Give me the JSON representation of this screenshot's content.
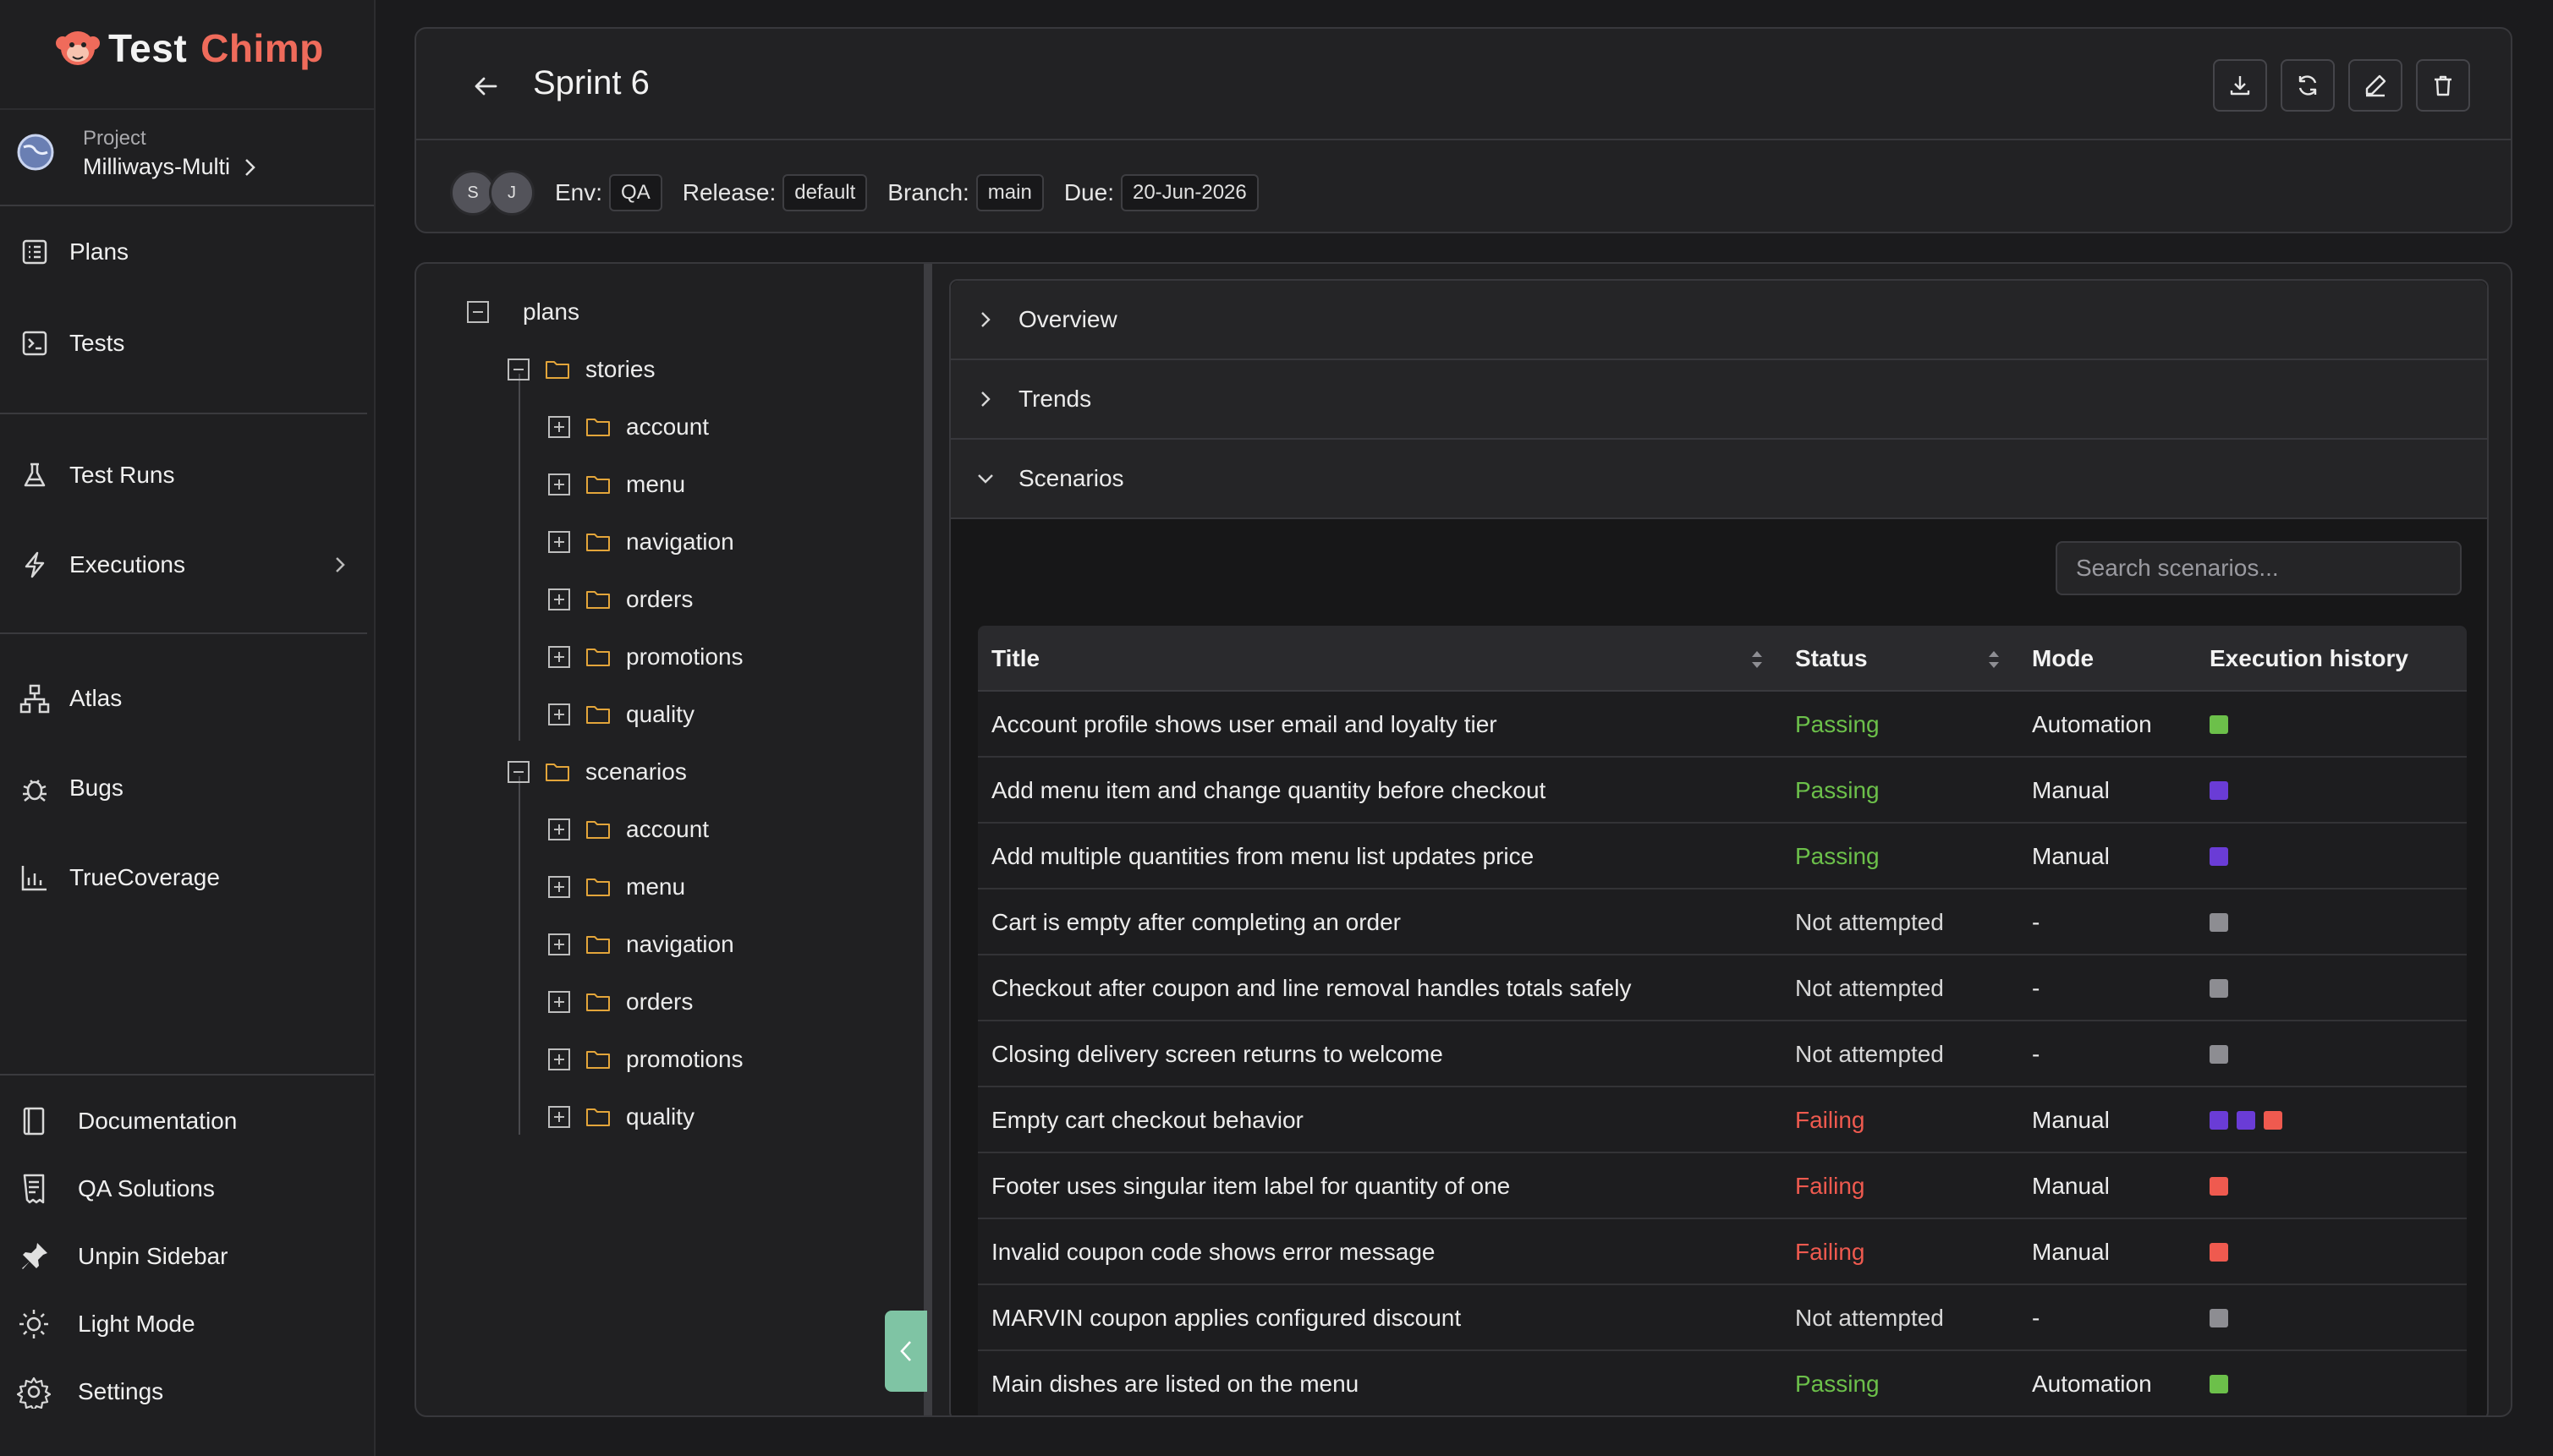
{
  "brand": {
    "word1": "Test",
    "word2": "Chimp"
  },
  "project": {
    "label": "Project",
    "name": "Milliways-Multi"
  },
  "nav": {
    "plans": "Plans",
    "tests": "Tests",
    "test_runs": "Test Runs",
    "executions": "Executions",
    "atlas": "Atlas",
    "bugs": "Bugs",
    "truecoverage": "TrueCoverage"
  },
  "bottom_nav": {
    "documentation": "Documentation",
    "qa_solutions": "QA Solutions",
    "unpin_sidebar": "Unpin Sidebar",
    "light_mode": "Light Mode",
    "settings": "Settings"
  },
  "header": {
    "title": "Sprint 6",
    "avatars": [
      "S",
      "J"
    ],
    "env_label": "Env:",
    "env_value": "QA",
    "release_label": "Release:",
    "release_value": "default",
    "branch_label": "Branch:",
    "branch_value": "main",
    "due_label": "Due:",
    "due_value": "20-Jun-2026"
  },
  "tree": {
    "root": "plans",
    "stories": {
      "label": "stories",
      "children": [
        "account",
        "menu",
        "navigation",
        "orders",
        "promotions",
        "quality"
      ]
    },
    "scenarios": {
      "label": "scenarios",
      "children": [
        "account",
        "menu",
        "navigation",
        "orders",
        "promotions",
        "quality"
      ]
    }
  },
  "accordion": {
    "overview": "Overview",
    "trends": "Trends",
    "scenarios": "Scenarios"
  },
  "search": {
    "placeholder": "Search scenarios..."
  },
  "table": {
    "headers": {
      "title": "Title",
      "status": "Status",
      "mode": "Mode",
      "history": "Execution history"
    },
    "rows": [
      {
        "title": "Account profile shows user email and loyalty tier",
        "status": "Passing",
        "mode": "Automation",
        "history": [
          "green"
        ]
      },
      {
        "title": "Add menu item and change quantity before checkout",
        "status": "Passing",
        "mode": "Manual",
        "history": [
          "purple"
        ]
      },
      {
        "title": "Add multiple quantities from menu list updates price",
        "status": "Passing",
        "mode": "Manual",
        "history": [
          "purple"
        ]
      },
      {
        "title": "Cart is empty after completing an order",
        "status": "Not attempted",
        "mode": "-",
        "history": [
          "gray"
        ]
      },
      {
        "title": "Checkout after coupon and line removal handles totals safely",
        "status": "Not attempted",
        "mode": "-",
        "history": [
          "gray"
        ]
      },
      {
        "title": "Closing delivery screen returns to welcome",
        "status": "Not attempted",
        "mode": "-",
        "history": [
          "gray"
        ]
      },
      {
        "title": "Empty cart checkout behavior",
        "status": "Failing",
        "mode": "Manual",
        "history": [
          "purple",
          "purple",
          "red"
        ]
      },
      {
        "title": "Footer uses singular item label for quantity of one",
        "status": "Failing",
        "mode": "Manual",
        "history": [
          "red"
        ]
      },
      {
        "title": "Invalid coupon code shows error message",
        "status": "Failing",
        "mode": "Manual",
        "history": [
          "red"
        ]
      },
      {
        "title": "MARVIN coupon applies configured discount",
        "status": "Not attempted",
        "mode": "-",
        "history": [
          "gray"
        ]
      },
      {
        "title": "Main dishes are listed on the menu",
        "status": "Passing",
        "mode": "Automation",
        "history": [
          "green"
        ]
      }
    ]
  },
  "colors": {
    "green": "#6cc04a",
    "purple": "#6a3cd6",
    "red": "#ef5a4f",
    "gray": "#8d8d92",
    "brand_accent": "#ef6b5b",
    "collapse_tab": "#7fc4a4"
  },
  "icons": {
    "header_actions": [
      "download-icon",
      "refresh-icon",
      "edit-icon",
      "trash-icon"
    ]
  }
}
